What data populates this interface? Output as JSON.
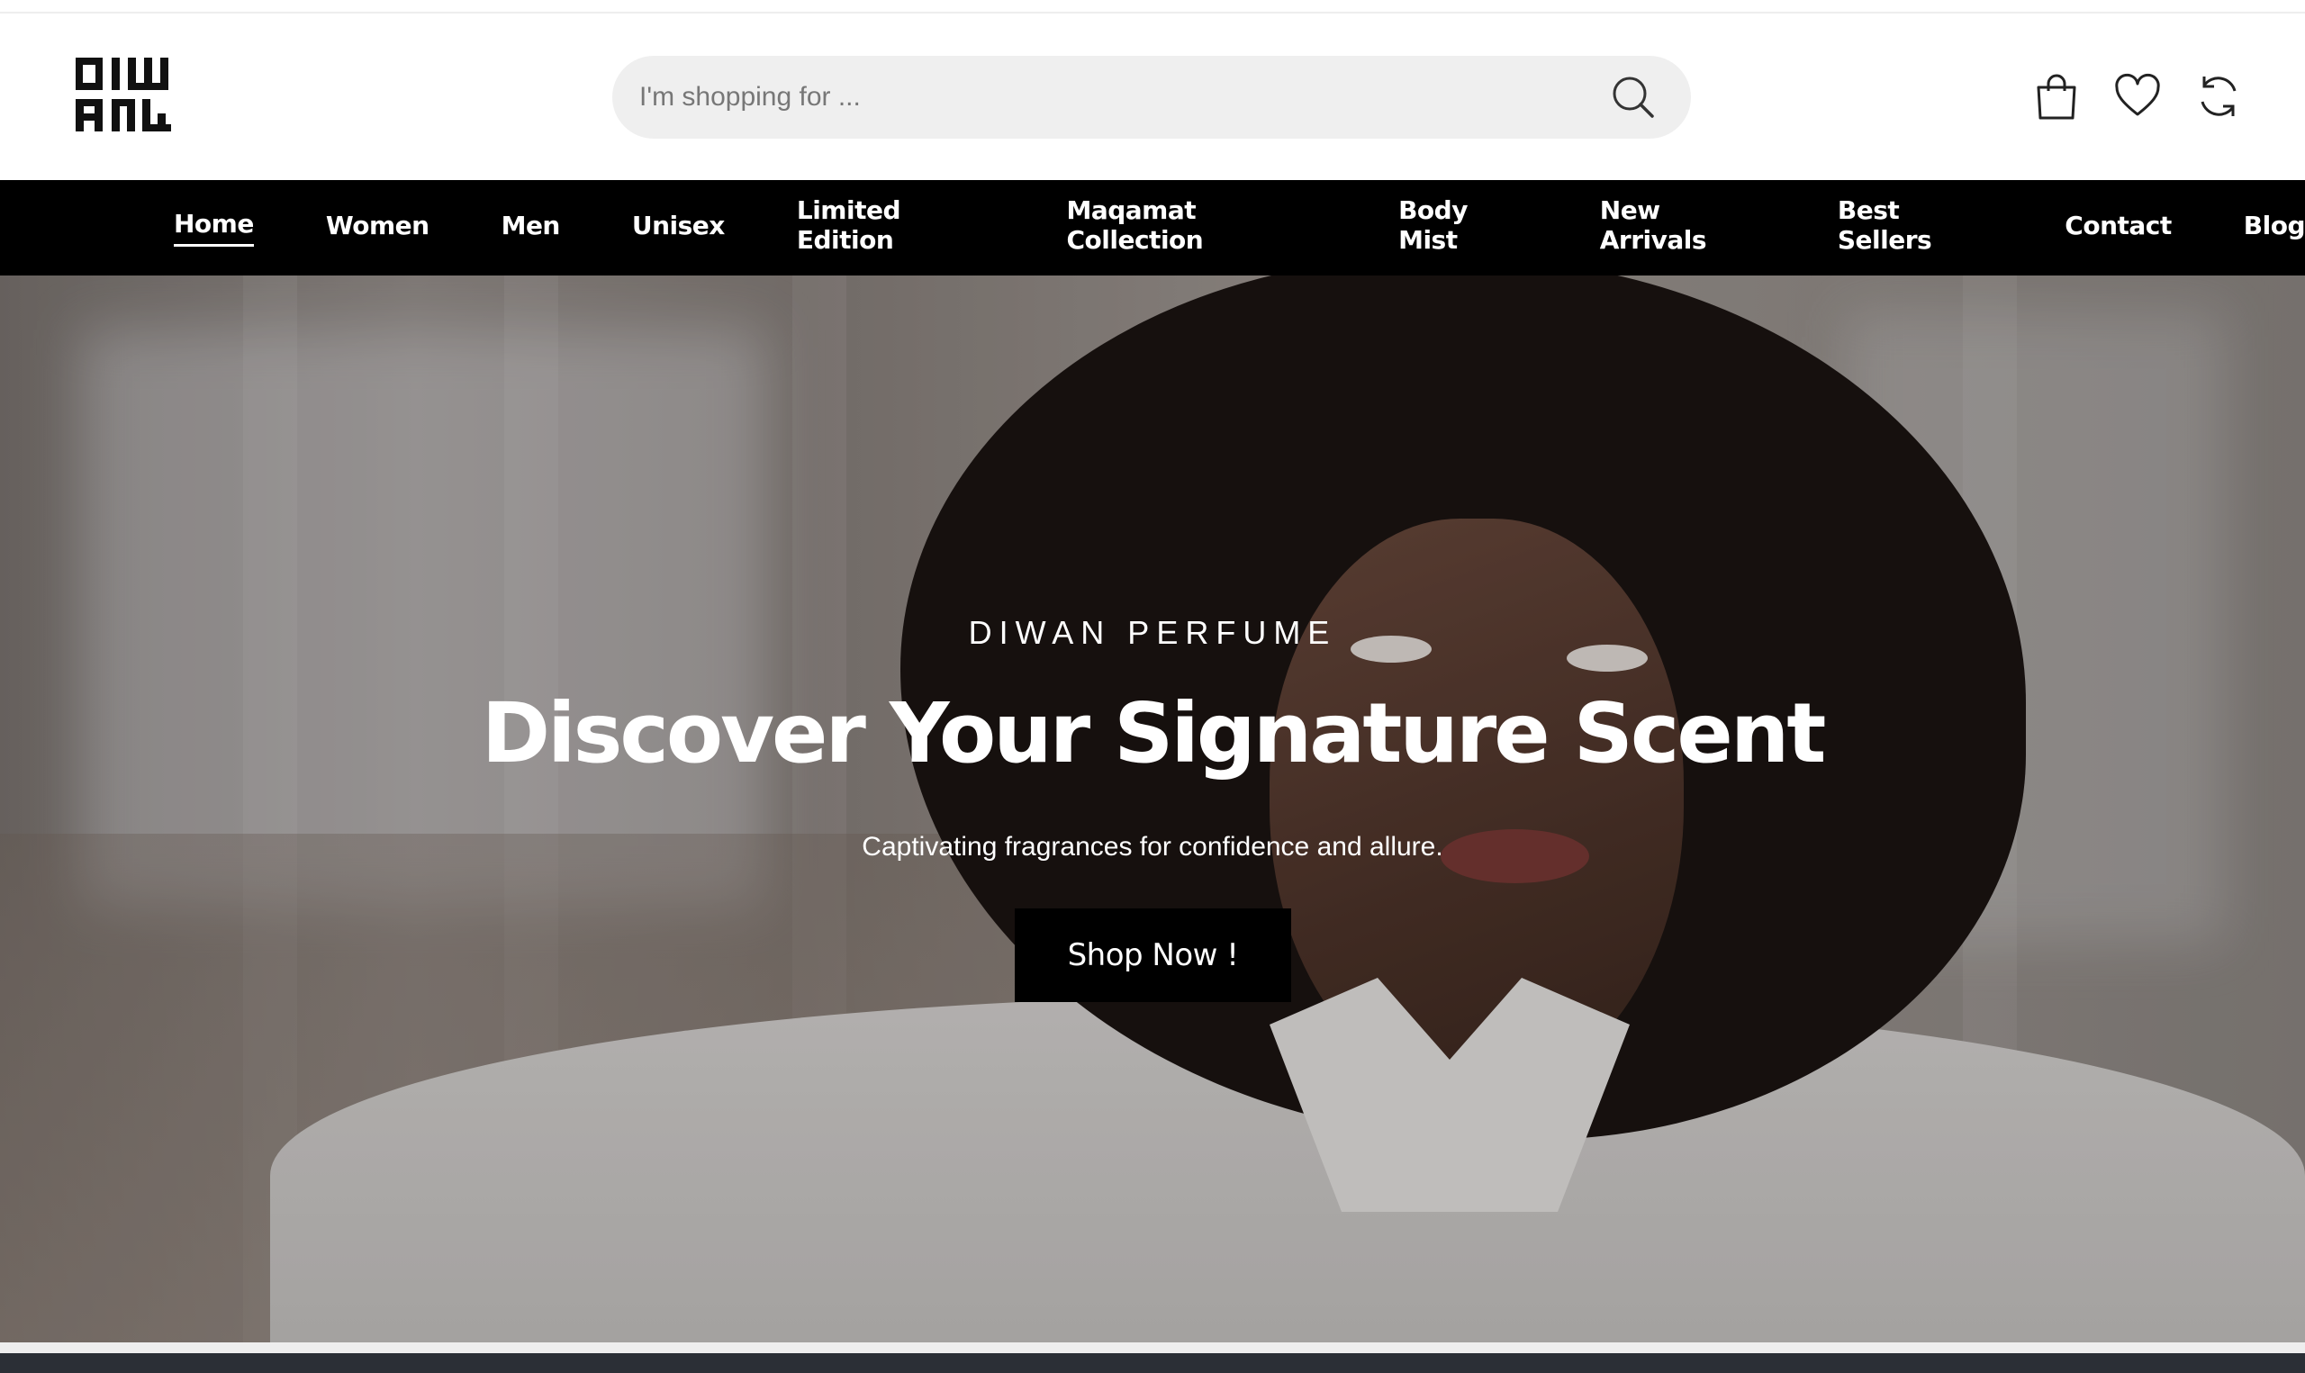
{
  "brand": {
    "logo_text": "DIWAN"
  },
  "search": {
    "placeholder": "I'm shopping for ...",
    "value": "",
    "icon": "search-icon"
  },
  "header_icons": [
    {
      "name": "cart-icon"
    },
    {
      "name": "heart-icon"
    },
    {
      "name": "refresh-compare-icon"
    }
  ],
  "nav": {
    "items": [
      {
        "label": "Home",
        "active": true
      },
      {
        "label": "Women"
      },
      {
        "label": "Men"
      },
      {
        "label": "Unisex"
      },
      {
        "label": "Limited Edition"
      },
      {
        "label": "Maqamat Collection"
      },
      {
        "label": "Body Mist"
      },
      {
        "label": "New Arrivals"
      },
      {
        "label": "Best Sellers"
      },
      {
        "label": "Contact"
      },
      {
        "label": "Blog"
      }
    ]
  },
  "hero": {
    "eyebrow": "DIWAN PERFUME",
    "title": "Discover Your Signature Scent",
    "subtitle": "Captivating fragrances for confidence and allure.",
    "cta": "Shop Now !"
  },
  "colors": {
    "nav_bg": "#000000",
    "search_bg": "#efefef",
    "button_bg": "#000000",
    "text_light": "#ffffff"
  }
}
